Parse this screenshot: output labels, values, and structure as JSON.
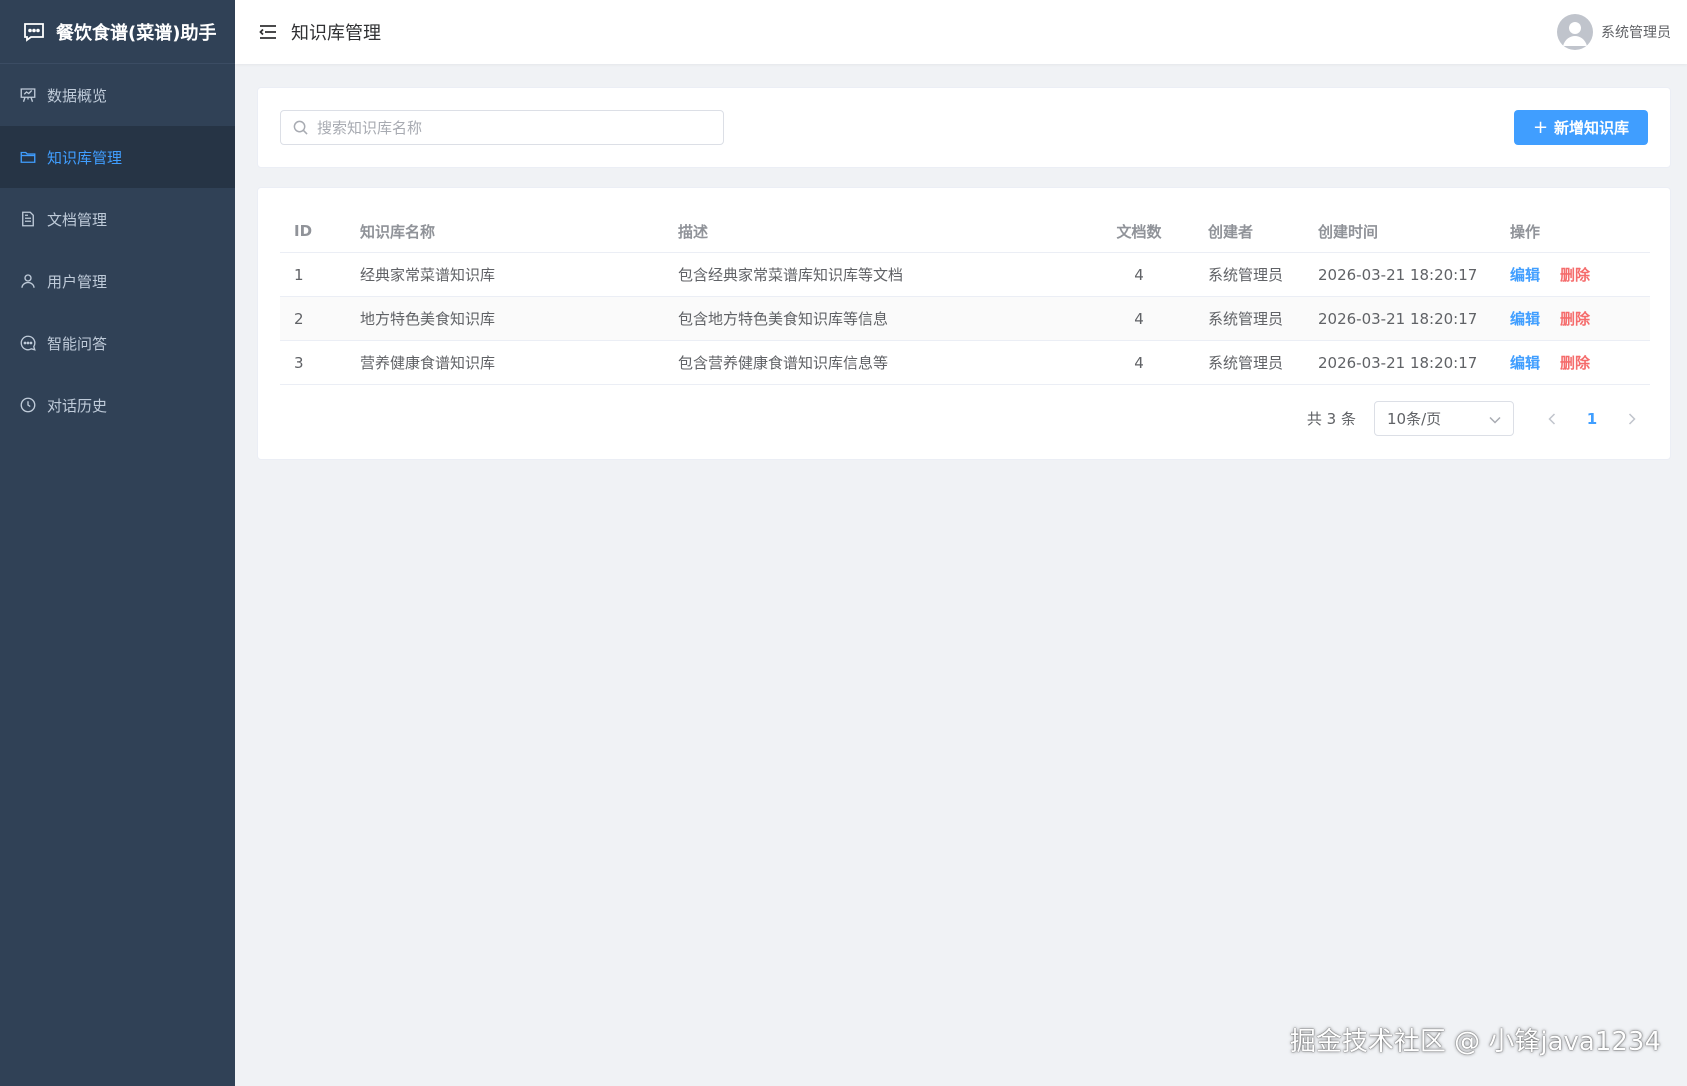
{
  "app": {
    "title": "餐饮食谱(菜谱)助手"
  },
  "sidebar": {
    "items": [
      {
        "label": "数据概览",
        "icon": "presentation-icon",
        "active": false
      },
      {
        "label": "知识库管理",
        "icon": "folder-icon",
        "active": true
      },
      {
        "label": "文档管理",
        "icon": "document-icon",
        "active": false
      },
      {
        "label": "用户管理",
        "icon": "user-icon",
        "active": false
      },
      {
        "label": "智能问答",
        "icon": "chat-icon",
        "active": false
      },
      {
        "label": "对话历史",
        "icon": "clock-icon",
        "active": false
      }
    ]
  },
  "header": {
    "page_title": "知识库管理",
    "username": "系统管理员"
  },
  "search": {
    "placeholder": "搜索知识库名称",
    "value": "",
    "add_label": "新增知识库"
  },
  "table": {
    "columns": [
      "ID",
      "知识库名称",
      "描述",
      "文档数",
      "创建者",
      "创建时间",
      "操作"
    ],
    "rows": [
      {
        "id": "1",
        "name": "经典家常菜谱知识库",
        "desc": "包含经典家常菜谱库知识库等文档",
        "docs": "4",
        "creator": "系统管理员",
        "time": "2026-03-21 18:20:17"
      },
      {
        "id": "2",
        "name": "地方特色美食知识库",
        "desc": "包含地方特色美食知识库等信息",
        "docs": "4",
        "creator": "系统管理员",
        "time": "2026-03-21 18:20:17"
      },
      {
        "id": "3",
        "name": "营养健康食谱知识库",
        "desc": "包含营养健康食谱知识库信息等",
        "docs": "4",
        "creator": "系统管理员",
        "time": "2026-03-21 18:20:17"
      }
    ],
    "edit_label": "编辑",
    "delete_label": "删除"
  },
  "pagination": {
    "total_text": "共 3 条",
    "page_size": "10条/页",
    "current_page": "1"
  },
  "watermark": "掘金技术社区 @ 小锋java1234",
  "colors": {
    "sidebar_bg": "#304156",
    "accent": "#409eff",
    "danger": "#f56c6c"
  }
}
